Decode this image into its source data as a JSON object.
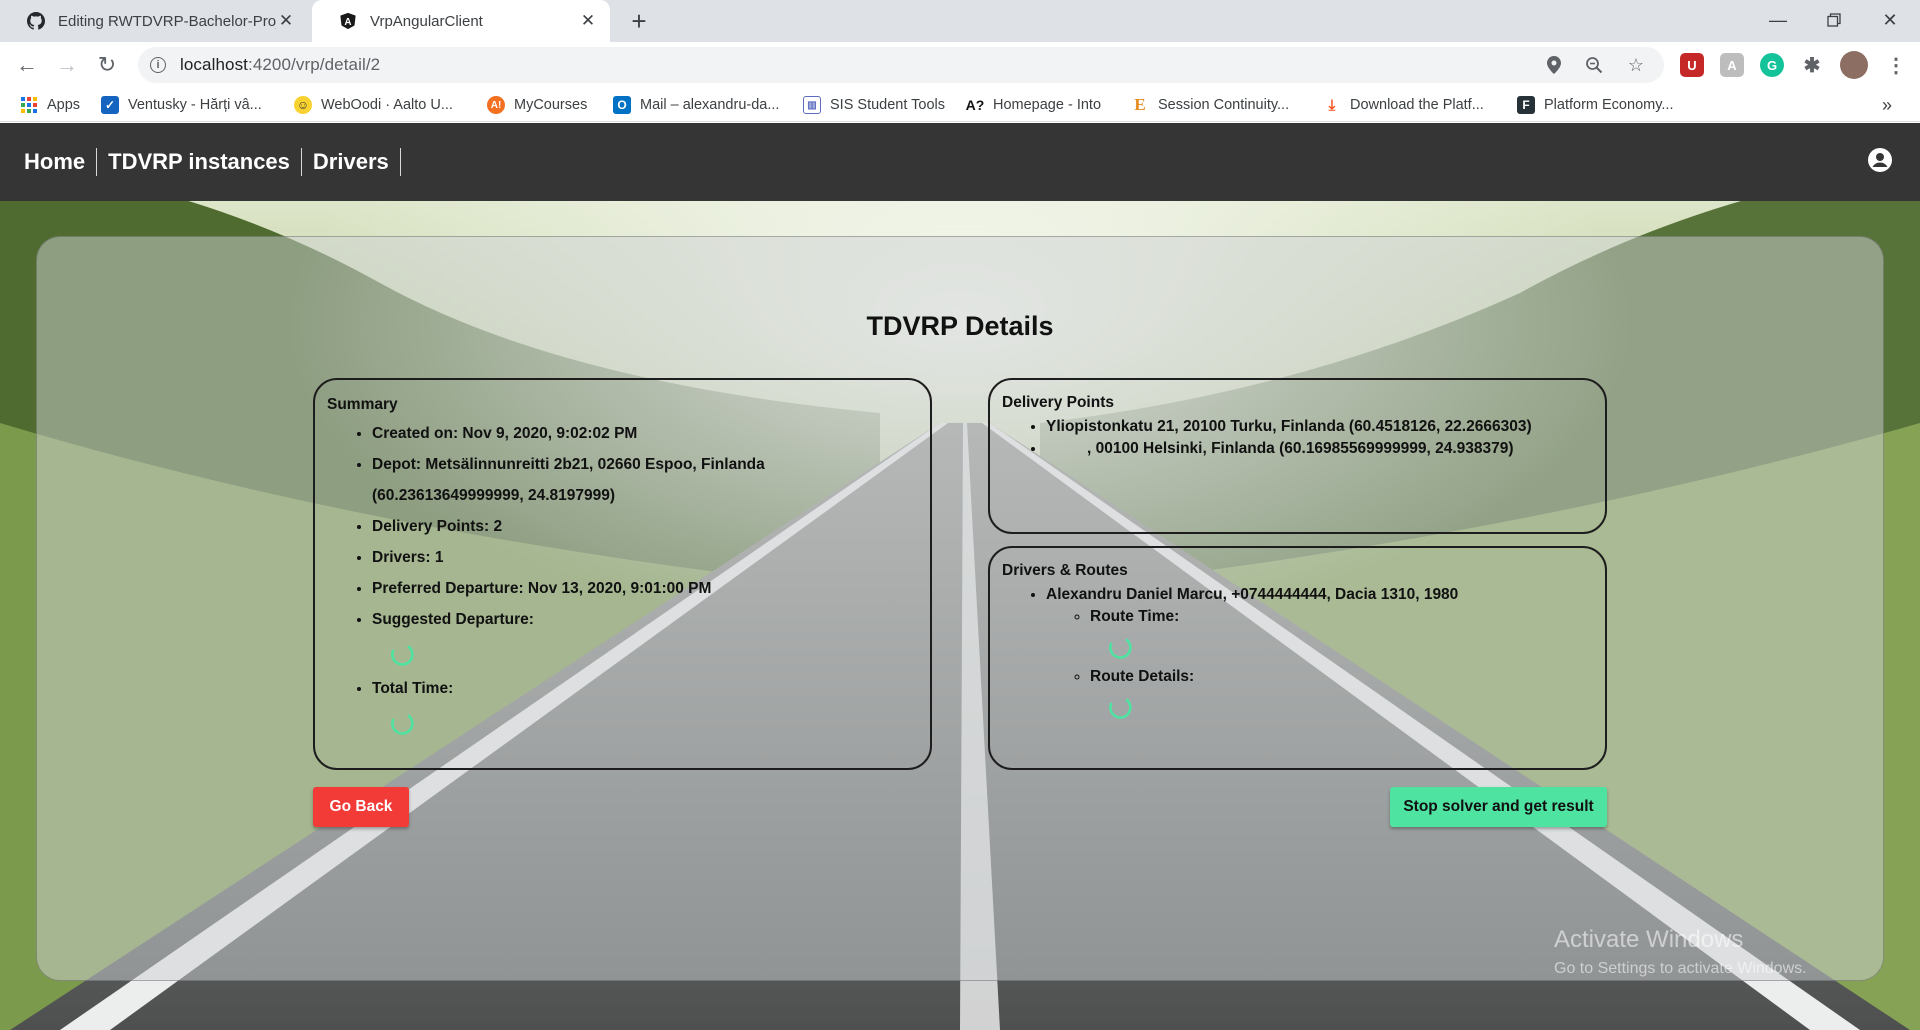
{
  "browser": {
    "tabs": [
      {
        "title": "Editing RWTDVRP-Bachelor-Proje",
        "icon": "github-icon",
        "active": false
      },
      {
        "title": "VrpAngularClient",
        "icon": "angular-icon",
        "active": true
      }
    ],
    "new_tab": "+",
    "url_host": "localhost",
    "url_path": ":4200/vrp/detail/2",
    "bookmarks": [
      {
        "label": "Apps",
        "icon": "apps-grid-icon"
      },
      {
        "label": "Ventusky - Hărți vâ...",
        "icon": "ventusky-icon"
      },
      {
        "label": "WebOodi · Aalto U...",
        "icon": "weboodi-icon"
      },
      {
        "label": "MyCourses",
        "icon": "mycourses-icon"
      },
      {
        "label": "Mail – alexandru-da...",
        "icon": "outlook-icon"
      },
      {
        "label": "SIS Student Tools",
        "icon": "sis-icon"
      },
      {
        "label": "Homepage - Into",
        "icon": "into-icon"
      },
      {
        "label": "Session Continuity...",
        "icon": "e-icon"
      },
      {
        "label": "Download the Platf...",
        "icon": "download-icon"
      },
      {
        "label": "Platform Economy...",
        "icon": "f-icon"
      }
    ],
    "more_bookmarks": "»"
  },
  "navbar": {
    "links": [
      "Home",
      "TDVRP instances",
      "Drivers"
    ]
  },
  "details": {
    "title": "TDVRP Details",
    "summary": {
      "heading": "Summary",
      "created": "Created on: Nov 9, 2020, 9:02:02 PM",
      "depot": "Depot: Metsälinnunreitti 2b21, 02660 Espoo, Finlanda (60.23613649999999, 24.8197999)",
      "delivery_points": "Delivery Points: 2",
      "drivers": "Drivers: 1",
      "preferred_departure": "Preferred Departure: Nov 13, 2020, 9:01:00 PM",
      "suggested_departure": "Suggested Departure:",
      "total_time": "Total Time:"
    },
    "delivery_points": {
      "heading": "Delivery Points",
      "items": [
        "Yliopistonkatu 21, 20100 Turku, Finlanda (60.4518126, 22.2666303)",
        ", 00100 Helsinki, Finlanda (60.16985569999999, 24.938379)"
      ]
    },
    "drivers_routes": {
      "heading": "Drivers & Routes",
      "driver": "Alexandru Daniel Marcu, +0744444444, Dacia 1310, 1980",
      "route_time": "Route Time:",
      "route_details": "Route Details:"
    },
    "buttons": {
      "back": "Go Back",
      "stop": "Stop solver and get result"
    }
  },
  "watermark": {
    "line1": "Activate Windows",
    "line2": "Go to Settings to activate Windows."
  },
  "colors": {
    "navbar": "#353535",
    "back_button": "#f23b37",
    "stop_button": "#4fe3a2",
    "spinner": "#4fe3a2"
  }
}
